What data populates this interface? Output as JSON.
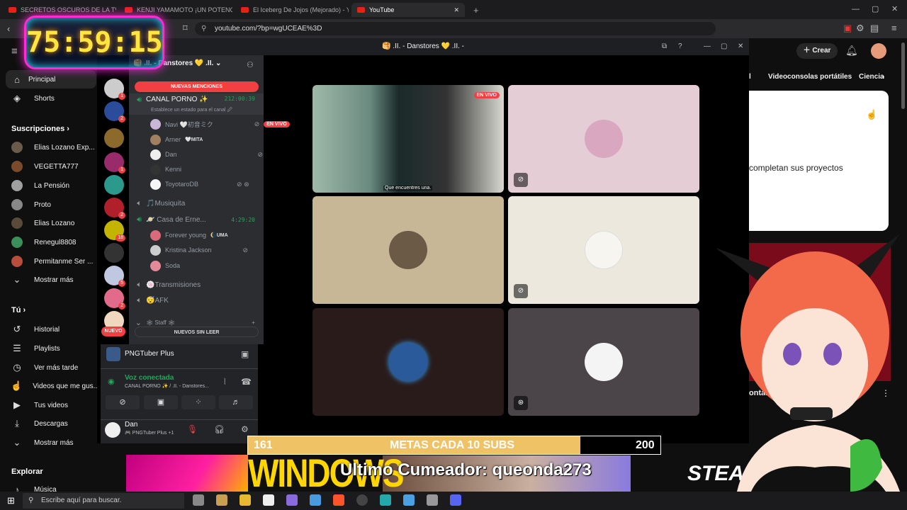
{
  "browser": {
    "tabs": [
      {
        "label": "SECRETOS OSCUROS DE LA TV | REC"
      },
      {
        "label": "KENJI YAMAMOTO ¡UN POTENCIAL"
      },
      {
        "label": "El Iceberg De Jojos (Mejorado) - You"
      },
      {
        "label": "YouTube"
      }
    ],
    "new_tab": "+",
    "url": "youtube.com/?bp=wgUCEAE%3D"
  },
  "overlay": {
    "timer": "75:59:15",
    "goal_current": "161",
    "goal_label": "METAS CADA 10 SUBS",
    "goal_target": "200",
    "goal_progress": 0.805,
    "windows_banner": "WINDOWS",
    "last_cumeador": "Ultimo Cumeador: queonda273",
    "steam_text": "STEA"
  },
  "youtube": {
    "create_label": "Crear",
    "sidebar": {
      "main": [
        {
          "label": "Principal",
          "icon": "home-icon"
        },
        {
          "label": "Shorts",
          "icon": "shorts-icon"
        }
      ],
      "subs_header": "Suscripciones",
      "subs": [
        {
          "label": "Elias Lozano Exp...",
          "color": "#6b5b4b"
        },
        {
          "label": "VEGETTA777",
          "color": "#7a4b2a"
        },
        {
          "label": "La Pensión",
          "color": "#a0a0a0"
        },
        {
          "label": "Proto",
          "color": "#888"
        },
        {
          "label": "Elias Lozano",
          "color": "#5a4a3a"
        },
        {
          "label": "Renegul8808",
          "color": "#3b8f5a"
        },
        {
          "label": "Permitanme Ser ...",
          "color": "#b94d3c"
        }
      ],
      "show_more": "Mostrar más",
      "you_header": "Tú",
      "you": [
        {
          "label": "Historial",
          "icon": "history-icon"
        },
        {
          "label": "Playlists",
          "icon": "playlist-icon"
        },
        {
          "label": "Ver más tarde",
          "icon": "clock-icon"
        },
        {
          "label": "Videos que me gus...",
          "icon": "like-icon"
        },
        {
          "label": "Tus videos",
          "icon": "video-icon"
        },
        {
          "label": "Descargas",
          "icon": "download-icon"
        }
      ],
      "show_more_2": "Mostrar más",
      "explore_header": "Explorar",
      "explore": [
        {
          "label": "Música",
          "icon": "music-icon"
        }
      ]
    },
    "chips": [
      "l",
      "Videoconsolas portátiles",
      "Ciencia"
    ],
    "card_text": "completan sus proyectos",
    "video_title_fragment": "ontar aquello que ?"
  },
  "discord": {
    "window_title": "🥞 .ΙΙ. - Danstores 💛 .ΙΙ. -",
    "server_name": "🥞 .ΙΙ. - Danstores 💛 .ΙΙ.",
    "new_mentions": "NUEVAS MENCIONES",
    "unread": "NUEVOS SIN LEER",
    "nuevo": "NUEVO",
    "server_badges": [
      "1",
      "2",
      "",
      "1",
      "",
      "2",
      "18",
      "",
      "5",
      "2",
      ""
    ],
    "channels": [
      {
        "name": "CANAL PORNO ✨",
        "time": "212:00:39",
        "status": "Establece un estado para el canal 🖉"
      },
      {
        "name": "🎵Musiquita"
      },
      {
        "name": "🪐 Casa de Erne...",
        "time": "4:29:20"
      },
      {
        "name": "🍥Transmisiones"
      },
      {
        "name": "😴AFK"
      },
      {
        "name": "🕸 Staff 🕸"
      }
    ],
    "users_canal": [
      {
        "name": "Navi 🤍初音ミク",
        "live": "EN VIVO"
      },
      {
        "name": "Arner",
        "tag": "🤍MITA"
      },
      {
        "name": "Dan"
      },
      {
        "name": "Kenni"
      },
      {
        "name": "ToyotaroDB"
      }
    ],
    "users_casa": [
      {
        "name": "Forever young",
        "tag": "🌘UMA"
      },
      {
        "name": "Kristina Jackson"
      },
      {
        "name": "Soda"
      }
    ],
    "activity": "PNGTuber Plus",
    "voice_status": "Voz conectada",
    "voice_channel": "CANAL PORNO ✨ / .ΙΙ. - Danstores...",
    "user_name": "Dan",
    "user_activity": "🎮 PNGTuber Plus +1",
    "live_badge": "EN VIVO",
    "subtitle": "Que encuentres una."
  }
}
